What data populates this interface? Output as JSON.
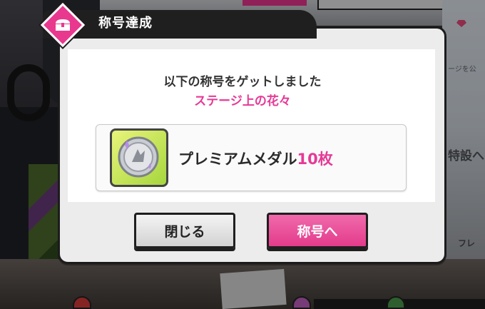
{
  "dialog": {
    "title": "称号達成",
    "message": "以下の称号をゲットしました",
    "title_name": "ステージ上の花々",
    "reward": {
      "item_name": "プレミアムメダル",
      "item_count": "10枚",
      "icon": "premium-medal-icon"
    },
    "buttons": {
      "close_label": "閉じる",
      "go_title_label": "称号へ"
    }
  },
  "background": {
    "side_text": "特設へ",
    "side_text_small": "ージを公",
    "bottom_text": "フレ"
  },
  "colors": {
    "accent_pink": "#e63a96",
    "dark": "#1f1f1f",
    "medal_frame_green": "#a6d63e"
  }
}
